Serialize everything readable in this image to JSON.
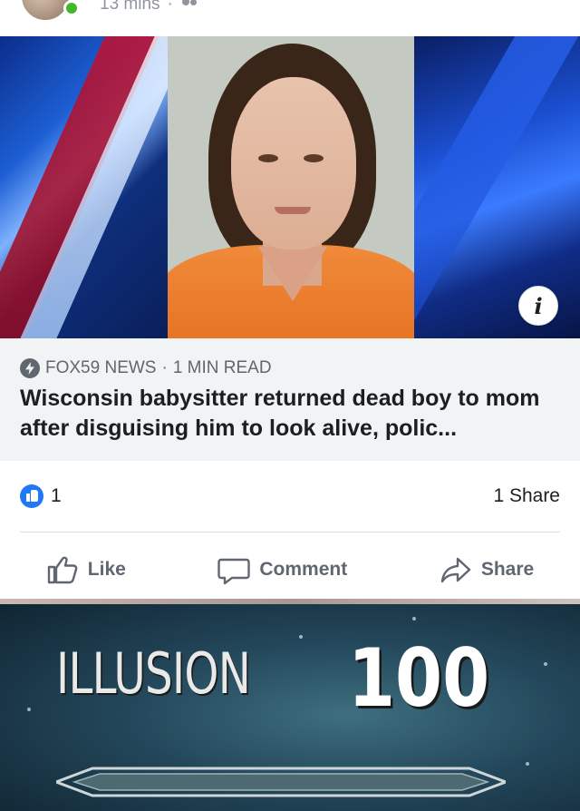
{
  "post_header": {
    "timestamp": "13 mins",
    "separator": "·",
    "privacy_icon": "friends-icon"
  },
  "link_preview": {
    "info_label": "i",
    "source": "FOX59 NEWS",
    "dot": "·",
    "read_time": "1 MIN READ",
    "headline": "Wisconsin babysitter returned dead boy to mom after disguising him to look alive, polic..."
  },
  "counts": {
    "likes": "1",
    "shares": "1 Share"
  },
  "actions": {
    "like": "Like",
    "comment": "Comment",
    "share": "Share"
  },
  "meme": {
    "skill_name": "ILLUSION",
    "skill_level": "100"
  },
  "colors": {
    "facebook_blue": "#2078f4",
    "online_green": "#42b72a",
    "caption_bg": "#f2f3f5",
    "text_secondary": "#606770"
  }
}
